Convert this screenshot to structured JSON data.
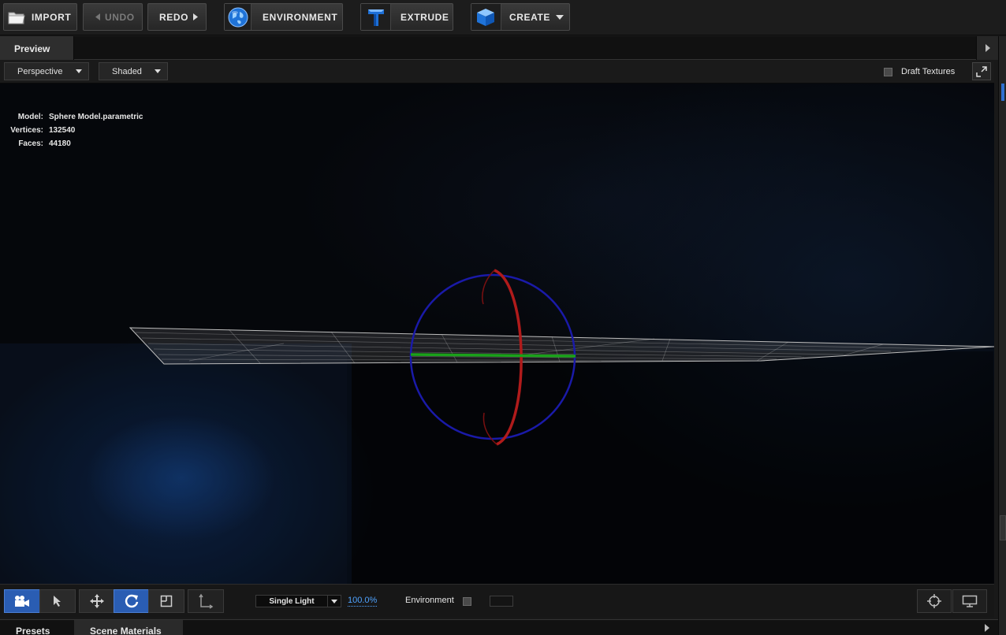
{
  "toolbar": {
    "import_label": "IMPORT",
    "undo_label": "UNDO",
    "redo_label": "REDO",
    "environment_label": "ENVIRONMENT",
    "extrude_label": "EXTRUDE",
    "create_label": "CREATE"
  },
  "preview": {
    "tab_label": "Preview",
    "view_mode": "Perspective",
    "render_mode": "Shaded",
    "draft_textures_label": "Draft Textures",
    "draft_textures_checked": false
  },
  "model_info": {
    "model_key": "Model:",
    "model_value": "Sphere Model.parametric",
    "vertices_key": "Vertices:",
    "vertices_value": "132540",
    "faces_key": "Faces:",
    "faces_value": "44180"
  },
  "bottom_toolbar": {
    "active_tools": [
      "camera-tool",
      "rotate-tool"
    ],
    "lighting_preset": "Single Light",
    "light_intensity": "100.0%",
    "environment_label": "Environment",
    "environment_checked": false
  },
  "bottom_tabs": {
    "presets_label": "Presets",
    "scene_materials_label": "Scene Materials"
  },
  "colors": {
    "accent_blue": "#2a5db3",
    "link_blue": "#4fa3ff",
    "gizmo_x": "#b01b1b",
    "gizmo_y": "#1aa11a",
    "gizmo_z": "#1a1aa8"
  },
  "icons": {
    "import": "folder-icon",
    "undo": "triangle-left-icon",
    "redo": "triangle-right-icon",
    "environment": "globe-icon",
    "extrude": "extrude-3d-t-icon",
    "create": "cube-icon"
  }
}
